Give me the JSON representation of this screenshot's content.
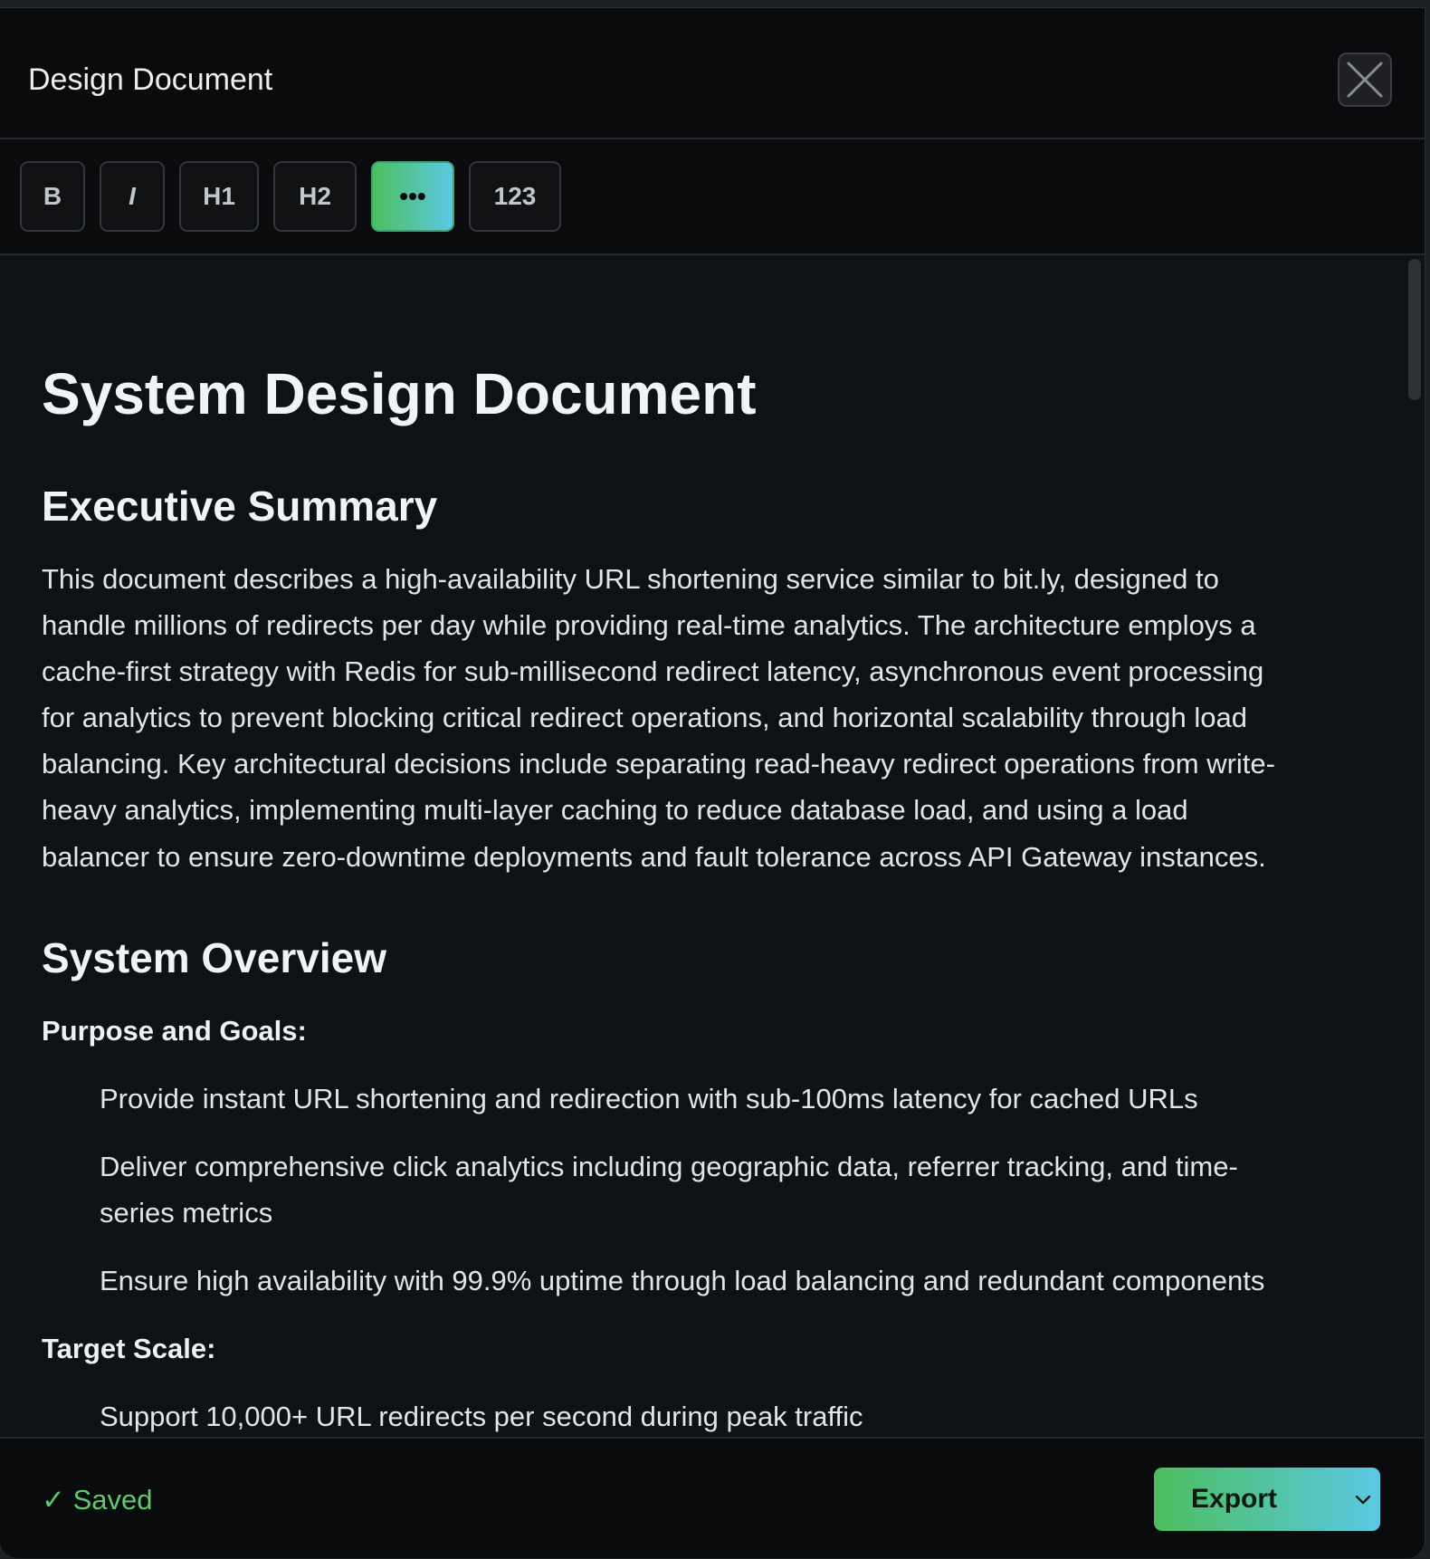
{
  "window": {
    "title": "Design Document"
  },
  "toolbar": {
    "bold_label": "B",
    "italic_label": "I",
    "h1_label": "H1",
    "h2_label": "H2",
    "more_label": "•••",
    "numbered_label": "123"
  },
  "doc": {
    "title": "System Design Document",
    "exec_heading": "Executive Summary",
    "exec_lines": [
      "This document describes a high-availability URL shortening service similar to bit.ly, designed to",
      "handle millions of redirects per day while providing real-time analytics. The architecture employs a",
      "cache-first strategy with Redis for sub-millisecond redirect latency, asynchronous event processing",
      "for analytics to prevent blocking critical redirect operations, and horizontal scalability through load",
      "balancing. Key architectural decisions include separating read-heavy redirect operations from write-",
      "heavy analytics, implementing multi-layer caching to reduce database load, and using a load",
      "balancer to ensure zero-downtime deployments and fault tolerance across API Gateway instances."
    ],
    "overview_heading": "System Overview",
    "purpose_label": "Purpose and Goals:",
    "purpose_items": [
      "Provide instant URL shortening and redirection with sub-100ms latency for cached URLs",
      "Deliver comprehensive click analytics including geographic data, referrer tracking, and time-",
      "series metrics",
      "Ensure high availability with 99.9% uptime through load balancing and redundant components"
    ],
    "scale_label": "Target Scale:",
    "scale_items": [
      "Support 10,000+ URL redirects per second during peak traffic"
    ]
  },
  "footer": {
    "status": "✓ Saved",
    "export_label": "Export"
  },
  "colors": {
    "accent_start": "#4cbe5e",
    "accent_end": "#5bc8e4",
    "saved_green": "#5fc96e"
  },
  "icons": {
    "close": "close-icon",
    "export_caret": "chevron-down-icon"
  }
}
